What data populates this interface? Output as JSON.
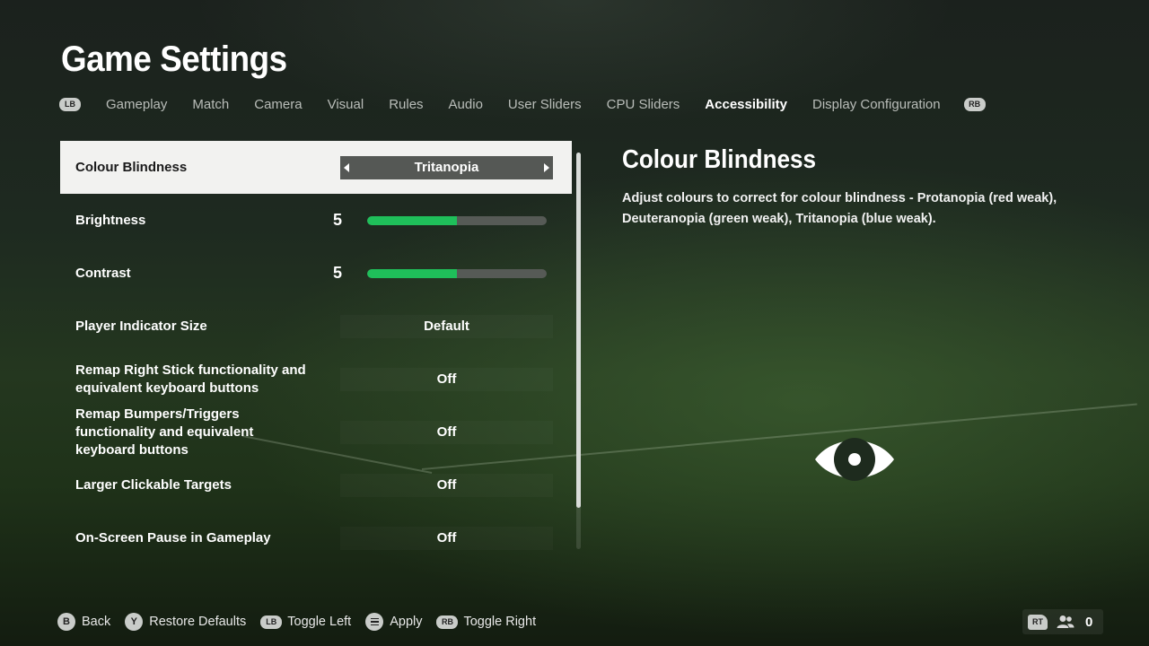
{
  "page": {
    "title": "Game Settings"
  },
  "tabs": {
    "left_bumper": "LB",
    "right_bumper": "RB",
    "items": [
      {
        "label": "Gameplay"
      },
      {
        "label": "Match"
      },
      {
        "label": "Camera"
      },
      {
        "label": "Visual"
      },
      {
        "label": "Rules"
      },
      {
        "label": "Audio"
      },
      {
        "label": "User Sliders"
      },
      {
        "label": "CPU Sliders"
      },
      {
        "label": "Accessibility",
        "active": true
      },
      {
        "label": "Display Configuration"
      }
    ]
  },
  "settings": [
    {
      "label": "Colour Blindness",
      "value": "Tritanopia",
      "type": "selector",
      "selected": true
    },
    {
      "label": "Brightness",
      "value": "5",
      "type": "slider",
      "level": 0.5
    },
    {
      "label": "Contrast",
      "value": "5",
      "type": "slider",
      "level": 0.5
    },
    {
      "label": "Player Indicator Size",
      "value": "Default",
      "type": "option"
    },
    {
      "label": "Remap Right Stick functionality and equivalent keyboard buttons",
      "value": "Off",
      "type": "option"
    },
    {
      "label": "Remap Bumpers/Triggers functionality and equivalent keyboard buttons",
      "value": "Off",
      "type": "option"
    },
    {
      "label": "Larger Clickable Targets",
      "value": "Off",
      "type": "option"
    },
    {
      "label": "On-Screen Pause in Gameplay",
      "value": "Off",
      "type": "option"
    }
  ],
  "detail": {
    "title": "Colour Blindness",
    "description": "Adjust colours to correct for colour blindness - Protanopia (red weak), Deuteranopia (green weak), Tritanopia (blue weak).",
    "icon": "eye-icon"
  },
  "footer": {
    "hints": [
      {
        "button": "B",
        "label": "Back",
        "shape": "circle"
      },
      {
        "button": "Y",
        "label": "Restore Defaults",
        "shape": "circle"
      },
      {
        "button": "LB",
        "label": "Toggle Left",
        "shape": "pill"
      },
      {
        "button": "",
        "label": "Apply",
        "shape": "menu"
      },
      {
        "button": "RB",
        "label": "Toggle Right",
        "shape": "pill"
      }
    ],
    "counter": {
      "button": "RT",
      "icon": "people-icon",
      "value": "0"
    }
  },
  "colors": {
    "accent": "#1fbf5a",
    "selected_row_bg": "#f2f2f0",
    "inactive_tab": "#b9bdb9"
  }
}
